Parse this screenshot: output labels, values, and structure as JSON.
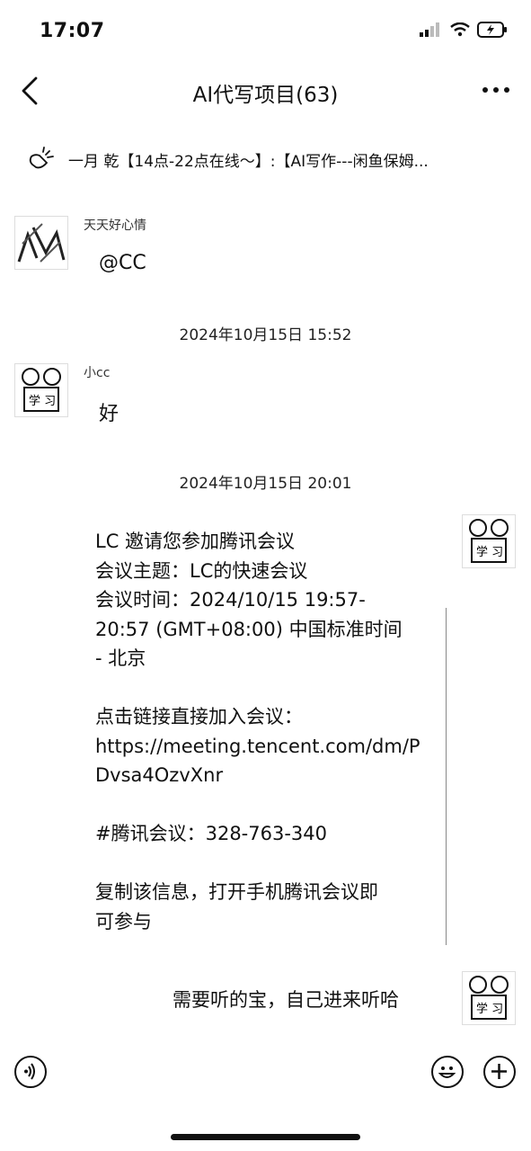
{
  "status_bar": {
    "time": "17:07"
  },
  "nav": {
    "title": "AI代写项目(63)"
  },
  "announcement": {
    "text": "一月 乾【14点-22点在线～】:【AI写作---闲鱼保姆..."
  },
  "messages": [
    {
      "sender": "天天好心情",
      "text": "@CC"
    },
    {
      "timestamp": "2024年10月15日 15:52"
    },
    {
      "sender": "小cc",
      "text": "好"
    },
    {
      "timestamp": "2024年10月15日 20:01"
    },
    {
      "text": "LC 邀请您参加腾讯会议\n会议主题：LC的快速会议\n会议时间：2024/10/15 19:57-\n20:57 (GMT+08:00) 中国标准时间\n- 北京\n\n点击链接直接加入会议：\nhttps://meeting.tencent.com/dm/P\nDvsa4OzvXnr\n\n#腾讯会议：328-763-340\n\n复制该信息，打开手机腾讯会议即\n可参与"
    },
    {
      "text": "需要听的宝，自己进来听哈"
    }
  ],
  "icons": {
    "back": "chevron-left-icon",
    "more": "more-dots-icon",
    "announcement": "announcement-icon",
    "voice": "voice-icon",
    "emoji": "emoji-icon",
    "plus": "plus-icon"
  }
}
